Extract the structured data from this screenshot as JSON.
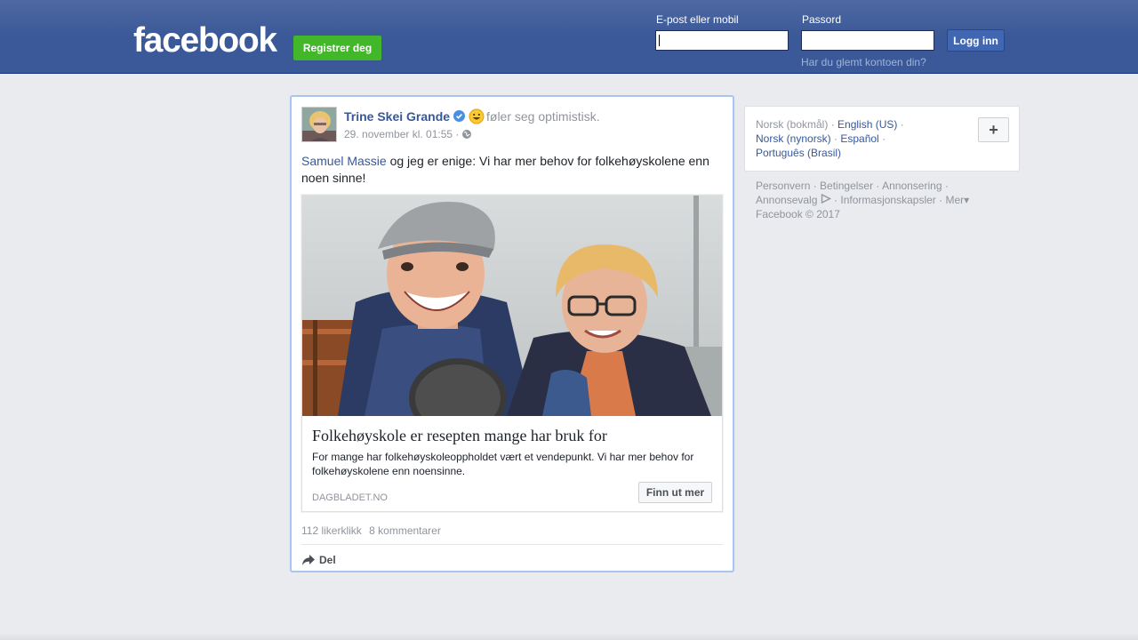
{
  "header": {
    "logo": "facebook",
    "register_label": "Registrer deg",
    "email_label": "E-post eller mobil",
    "password_label": "Passord",
    "email_value": "",
    "password_value": "",
    "login_label": "Logg inn",
    "forgot_label": "Har du glemt kontoen din?"
  },
  "post": {
    "author": "Trine Skei Grande",
    "feeling": "føler seg optimistisk.",
    "timestamp": "29. november kl. 01:55 ·",
    "mention": "Samuel Massie",
    "text_rest": " og jeg er enige: Vi har mer behov for folkehøyskolene enn noen sinne!",
    "link": {
      "title": "Folkehøyskole er resepten mange har bruk for",
      "description": "For mange har folkehøyskoleoppholdet vært et vendepunkt. Vi har mer behov for folkehøyskolene enn noensinne.",
      "domain": "DAGBLADET.NO",
      "cta_label": "Finn ut mer"
    },
    "likes": "112 likerklikk",
    "comments": "8 kommentarer",
    "share_label": "Del"
  },
  "languages": {
    "current": "Norsk (bokmål)",
    "options": [
      "English (US)",
      "Norsk (nynorsk)",
      "Español",
      "Português (Brasil)"
    ],
    "add_label": "+"
  },
  "footer": {
    "links": [
      "Personvern",
      "Betingelser",
      "Annonsering",
      "Annonsevalg",
      "Informasjonskapsler",
      "Mer"
    ],
    "copyright": "Facebook © 2017"
  },
  "colors": {
    "brand_blue": "#3b5998",
    "link_blue": "#365899",
    "register_green": "#42b72a",
    "selected_border": "#a9c4ef"
  }
}
